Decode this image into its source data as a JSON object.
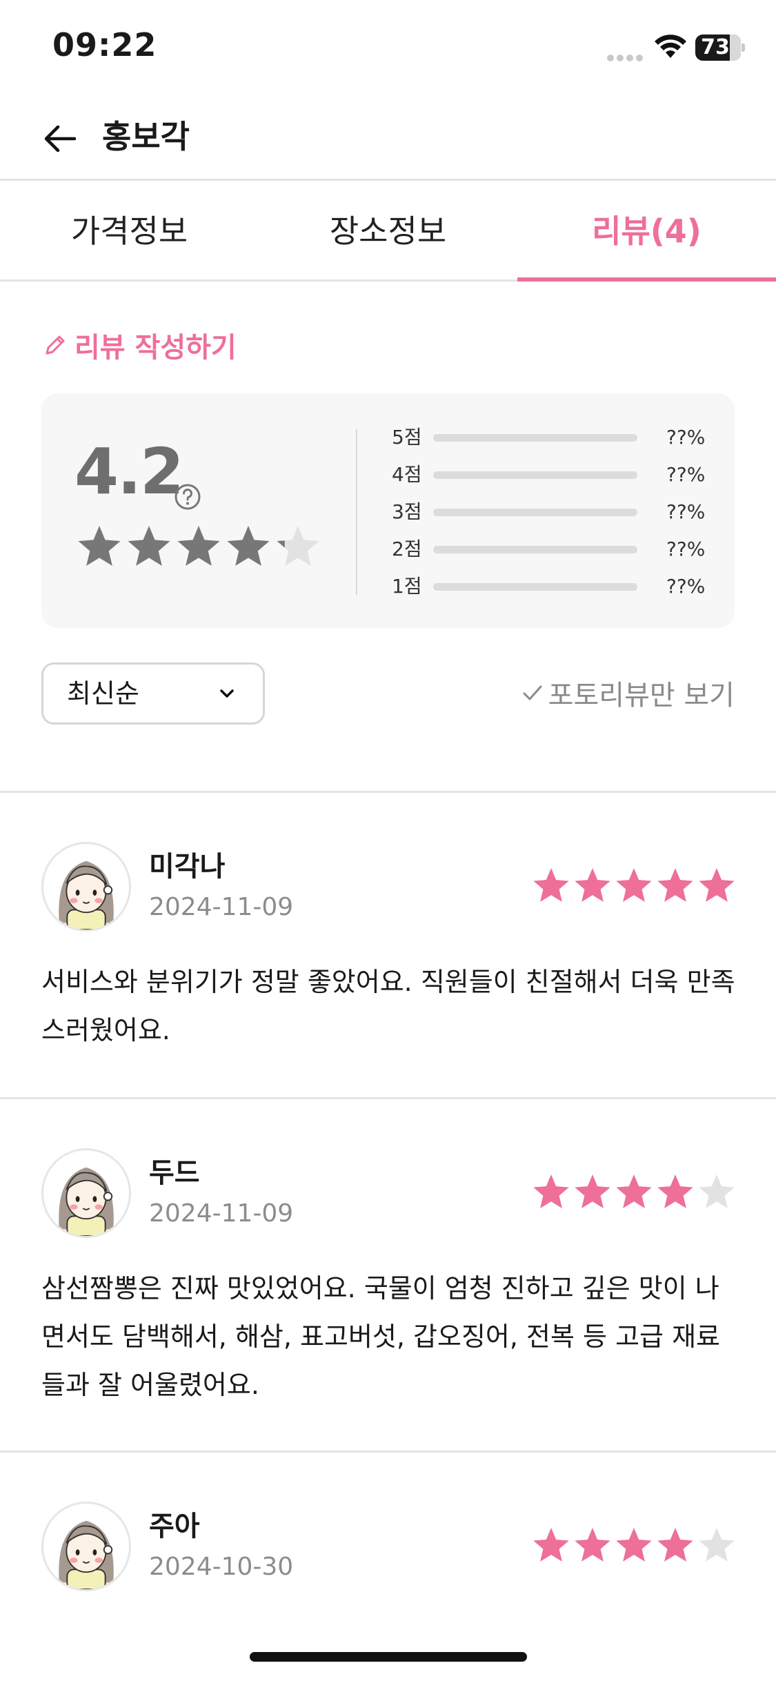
{
  "status_bar": {
    "time": "09:22",
    "battery": "73"
  },
  "header": {
    "title": "홍보각"
  },
  "tabs": [
    {
      "label": "가격정보",
      "active": false
    },
    {
      "label": "장소정보",
      "active": false
    },
    {
      "label": "리뷰(4)",
      "active": true
    }
  ],
  "write_review_label": "리뷰 작성하기",
  "summary": {
    "average": "4.2",
    "average_stars": 4.2,
    "distribution": [
      {
        "label": "5점",
        "percent_text": "??%"
      },
      {
        "label": "4점",
        "percent_text": "??%"
      },
      {
        "label": "3점",
        "percent_text": "??%"
      },
      {
        "label": "2점",
        "percent_text": "??%"
      },
      {
        "label": "1점",
        "percent_text": "??%"
      }
    ]
  },
  "sort": {
    "selected": "최신순"
  },
  "photo_filter_label": "포토리뷰만 보기",
  "reviews": [
    {
      "name": "미각나",
      "date": "2024-11-09",
      "rating": 5,
      "text": "서비스와 분위기가 정말 좋았어요. 직원들이 친절해서 더욱 만족스러웠어요."
    },
    {
      "name": "두드",
      "date": "2024-11-09",
      "rating": 4,
      "text": "삼선짬뽕은 진짜 맛있었어요. 국물이 엄청 진하고 깊은 맛이 나면서도 담백해서, 해삼, 표고버섯, 갑오징어, 전복 등 고급 재료들과 잘 어울렸어요."
    },
    {
      "name": "주아",
      "date": "2024-10-30",
      "rating": 4,
      "text": ""
    }
  ],
  "colors": {
    "accent": "#ee6f98",
    "star_gray": "#777777",
    "star_empty": "#e2e2e2"
  }
}
